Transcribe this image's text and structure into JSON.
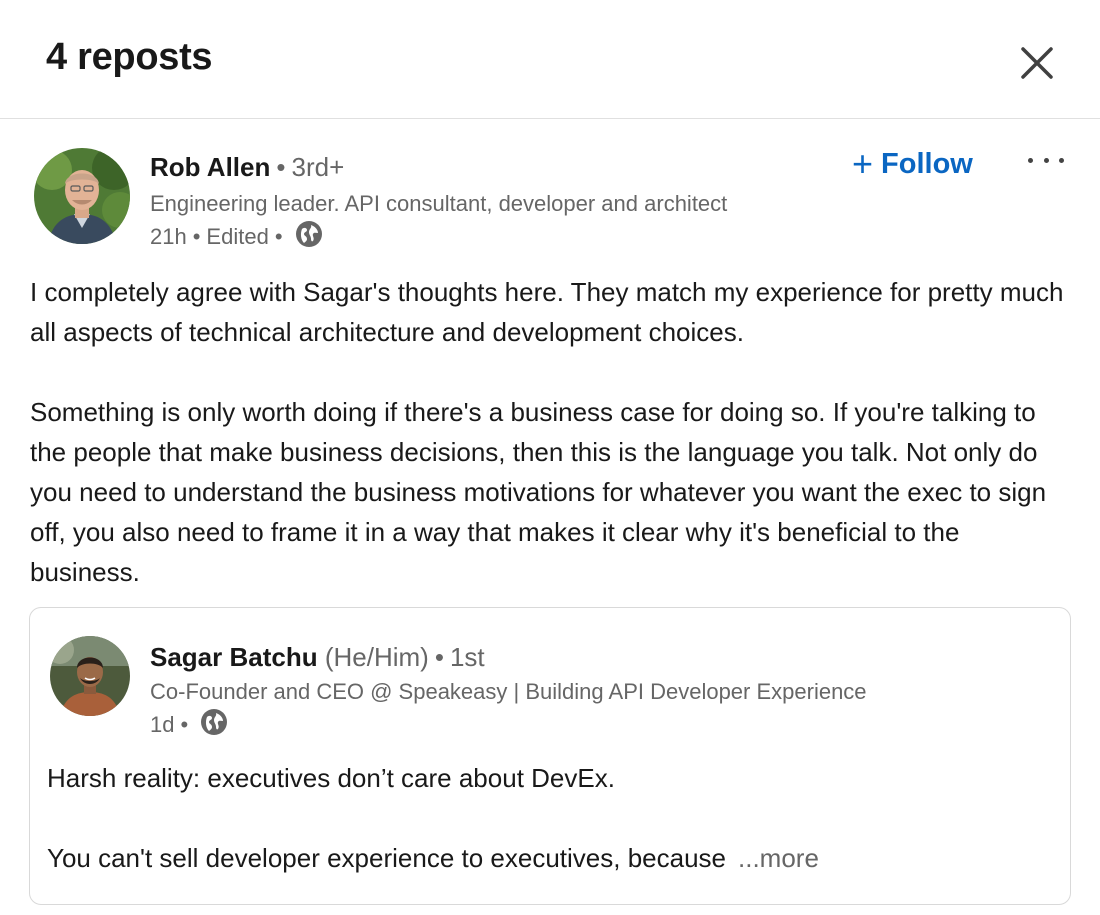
{
  "modal": {
    "title": "4 reposts",
    "close_icon": "close-icon"
  },
  "repost": {
    "author": {
      "name": "Rob Allen",
      "degree": "3rd+",
      "headline": "Engineering leader. API consultant, developer and architect",
      "time": "21h",
      "edited": "Edited",
      "visibility_icon": "globe-icon"
    },
    "follow_label": "Follow",
    "more_icon": "ellipsis-icon",
    "text": [
      "I completely agree with Sagar's thoughts here. They match my experience for pretty much all aspects of technical architecture and development choices.",
      "Something is only worth doing if there's a business case for doing so. If you're talking to the people that make business decisions, then this is the language you talk. Not only do you need to understand the business motivations for whatever you want the exec to sign off, you also need to frame it in a way that makes it clear why it's beneficial to the business."
    ]
  },
  "original_post": {
    "author": {
      "name": "Sagar Batchu",
      "pronouns": "(He/Him)",
      "degree": "1st",
      "headline": "Co-Founder and CEO @ Speakeasy | Building API Developer Experience",
      "time": "1d",
      "visibility_icon": "globe-icon"
    },
    "text": [
      "Harsh reality: executives don’t care about DevEx.",
      "You can't sell developer experience to executives, because"
    ],
    "see_more_label": "...more"
  },
  "colors": {
    "link_blue": "#0a66c2",
    "muted_text": "#666666",
    "border": "#d9d9d9"
  }
}
